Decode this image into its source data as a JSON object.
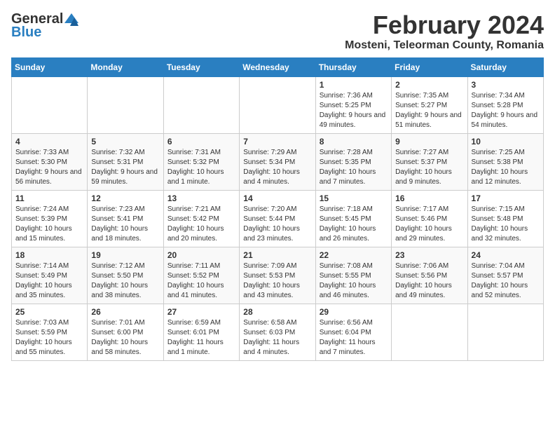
{
  "header": {
    "logo_general": "General",
    "logo_blue": "Blue",
    "month": "February 2024",
    "location": "Mosteni, Teleorman County, Romania"
  },
  "weekdays": [
    "Sunday",
    "Monday",
    "Tuesday",
    "Wednesday",
    "Thursday",
    "Friday",
    "Saturday"
  ],
  "weeks": [
    [
      {
        "day": "",
        "info": ""
      },
      {
        "day": "",
        "info": ""
      },
      {
        "day": "",
        "info": ""
      },
      {
        "day": "",
        "info": ""
      },
      {
        "day": "1",
        "info": "Sunrise: 7:36 AM\nSunset: 5:25 PM\nDaylight: 9 hours and 49 minutes."
      },
      {
        "day": "2",
        "info": "Sunrise: 7:35 AM\nSunset: 5:27 PM\nDaylight: 9 hours and 51 minutes."
      },
      {
        "day": "3",
        "info": "Sunrise: 7:34 AM\nSunset: 5:28 PM\nDaylight: 9 hours and 54 minutes."
      }
    ],
    [
      {
        "day": "4",
        "info": "Sunrise: 7:33 AM\nSunset: 5:30 PM\nDaylight: 9 hours and 56 minutes."
      },
      {
        "day": "5",
        "info": "Sunrise: 7:32 AM\nSunset: 5:31 PM\nDaylight: 9 hours and 59 minutes."
      },
      {
        "day": "6",
        "info": "Sunrise: 7:31 AM\nSunset: 5:32 PM\nDaylight: 10 hours and 1 minute."
      },
      {
        "day": "7",
        "info": "Sunrise: 7:29 AM\nSunset: 5:34 PM\nDaylight: 10 hours and 4 minutes."
      },
      {
        "day": "8",
        "info": "Sunrise: 7:28 AM\nSunset: 5:35 PM\nDaylight: 10 hours and 7 minutes."
      },
      {
        "day": "9",
        "info": "Sunrise: 7:27 AM\nSunset: 5:37 PM\nDaylight: 10 hours and 9 minutes."
      },
      {
        "day": "10",
        "info": "Sunrise: 7:25 AM\nSunset: 5:38 PM\nDaylight: 10 hours and 12 minutes."
      }
    ],
    [
      {
        "day": "11",
        "info": "Sunrise: 7:24 AM\nSunset: 5:39 PM\nDaylight: 10 hours and 15 minutes."
      },
      {
        "day": "12",
        "info": "Sunrise: 7:23 AM\nSunset: 5:41 PM\nDaylight: 10 hours and 18 minutes."
      },
      {
        "day": "13",
        "info": "Sunrise: 7:21 AM\nSunset: 5:42 PM\nDaylight: 10 hours and 20 minutes."
      },
      {
        "day": "14",
        "info": "Sunrise: 7:20 AM\nSunset: 5:44 PM\nDaylight: 10 hours and 23 minutes."
      },
      {
        "day": "15",
        "info": "Sunrise: 7:18 AM\nSunset: 5:45 PM\nDaylight: 10 hours and 26 minutes."
      },
      {
        "day": "16",
        "info": "Sunrise: 7:17 AM\nSunset: 5:46 PM\nDaylight: 10 hours and 29 minutes."
      },
      {
        "day": "17",
        "info": "Sunrise: 7:15 AM\nSunset: 5:48 PM\nDaylight: 10 hours and 32 minutes."
      }
    ],
    [
      {
        "day": "18",
        "info": "Sunrise: 7:14 AM\nSunset: 5:49 PM\nDaylight: 10 hours and 35 minutes."
      },
      {
        "day": "19",
        "info": "Sunrise: 7:12 AM\nSunset: 5:50 PM\nDaylight: 10 hours and 38 minutes."
      },
      {
        "day": "20",
        "info": "Sunrise: 7:11 AM\nSunset: 5:52 PM\nDaylight: 10 hours and 41 minutes."
      },
      {
        "day": "21",
        "info": "Sunrise: 7:09 AM\nSunset: 5:53 PM\nDaylight: 10 hours and 43 minutes."
      },
      {
        "day": "22",
        "info": "Sunrise: 7:08 AM\nSunset: 5:55 PM\nDaylight: 10 hours and 46 minutes."
      },
      {
        "day": "23",
        "info": "Sunrise: 7:06 AM\nSunset: 5:56 PM\nDaylight: 10 hours and 49 minutes."
      },
      {
        "day": "24",
        "info": "Sunrise: 7:04 AM\nSunset: 5:57 PM\nDaylight: 10 hours and 52 minutes."
      }
    ],
    [
      {
        "day": "25",
        "info": "Sunrise: 7:03 AM\nSunset: 5:59 PM\nDaylight: 10 hours and 55 minutes."
      },
      {
        "day": "26",
        "info": "Sunrise: 7:01 AM\nSunset: 6:00 PM\nDaylight: 10 hours and 58 minutes."
      },
      {
        "day": "27",
        "info": "Sunrise: 6:59 AM\nSunset: 6:01 PM\nDaylight: 11 hours and 1 minute."
      },
      {
        "day": "28",
        "info": "Sunrise: 6:58 AM\nSunset: 6:03 PM\nDaylight: 11 hours and 4 minutes."
      },
      {
        "day": "29",
        "info": "Sunrise: 6:56 AM\nSunset: 6:04 PM\nDaylight: 11 hours and 7 minutes."
      },
      {
        "day": "",
        "info": ""
      },
      {
        "day": "",
        "info": ""
      }
    ]
  ]
}
